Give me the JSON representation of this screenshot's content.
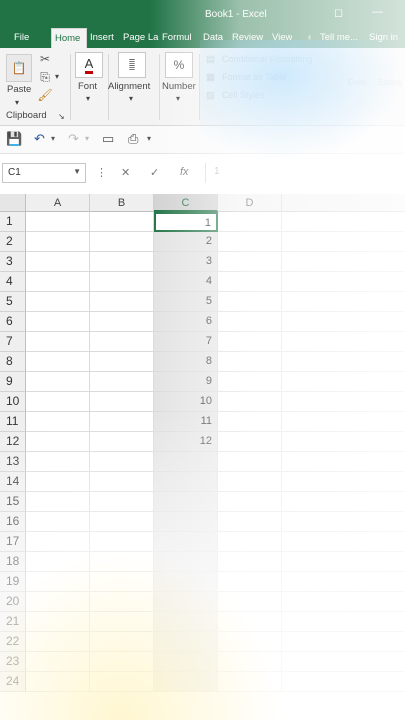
{
  "window": {
    "title": "Book1 - Excel",
    "restore_glyph": "◻",
    "minimize_glyph": "—"
  },
  "tabs": [
    "File",
    "Home",
    "Insert",
    "Page La",
    "Formul",
    "Data",
    "Review",
    "View"
  ],
  "active_tab": "Home",
  "tell_me": "Tell me...",
  "sign_in": "Sign in",
  "ribbon": {
    "paste_label": "Paste",
    "clipboard_label": "Clipboard",
    "font_label": "Font",
    "alignment_label": "Alignment",
    "number_label": "Number",
    "conditional_formatting": "Conditional Formatting",
    "format_as_table": "Format as Table",
    "cell_styles": "Cell Styles",
    "cells_label": "Cells",
    "editing_label": "Editing"
  },
  "formula_bar": {
    "name_box": "C1",
    "fx": "fx",
    "value": "1"
  },
  "columns": [
    "A",
    "B",
    "C",
    "D"
  ],
  "selected_column": "C",
  "rows": [
    "1",
    "2",
    "3",
    "4",
    "5",
    "6",
    "7",
    "8",
    "9",
    "10",
    "11",
    "12",
    "13",
    "14",
    "15",
    "16",
    "17",
    "18",
    "19",
    "20",
    "21",
    "22",
    "23",
    "24"
  ],
  "column_c_values": [
    "1",
    "2",
    "3",
    "4",
    "5",
    "6",
    "7",
    "8",
    "9",
    "10",
    "11",
    "12"
  ],
  "colors": {
    "excel_green": "#217346",
    "ribbon_bg": "#f3f3f3",
    "selection_gray": "#e3e3e3"
  }
}
